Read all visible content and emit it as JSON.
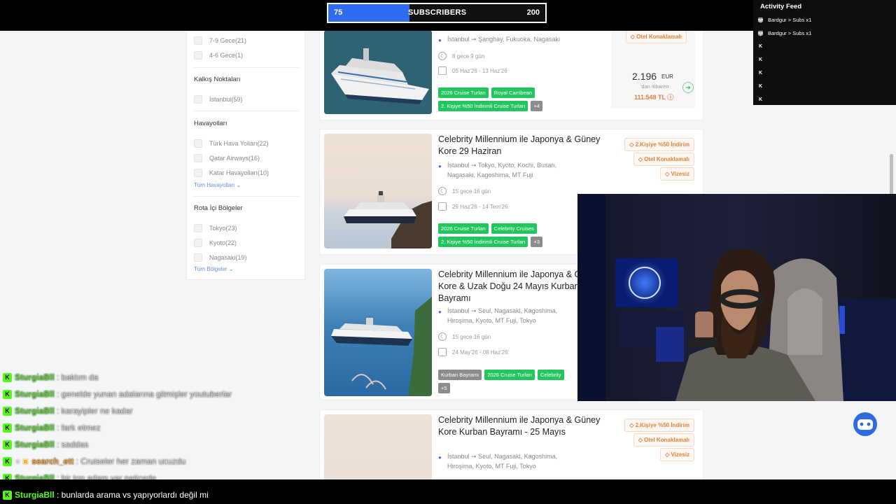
{
  "sub_goal": {
    "current": "75",
    "label": "SUBSCRIBERS",
    "goal": "200",
    "progress": 0.375
  },
  "filters": {
    "nights": [
      {
        "label": "7-9 Gece(21)"
      },
      {
        "label": "4-6 Gece(1)"
      }
    ],
    "departure_title": "Kalkış Noktaları",
    "departure": [
      {
        "label": "İstanbul(59)"
      }
    ],
    "airlines_title": "Havayolları",
    "airlines": [
      {
        "label": "Türk Hava Yolları(22)"
      },
      {
        "label": "Qatar Airways(16)"
      },
      {
        "label": "Katar Havayolları(10)"
      }
    ],
    "airlines_more": "Tüm Havayolları",
    "regions_title": "Rota İçi Bölgeler",
    "regions": [
      {
        "label": "Tokyo(23)"
      },
      {
        "label": "Kyoto(22)"
      },
      {
        "label": "Nagasaki(19)"
      }
    ],
    "regions_more": "Tüm Bölgeler"
  },
  "cards": [
    {
      "route": "İstanbul ➞ Şanghay, Fukuoka, Nagasaki",
      "duration": "8 gece 9 gün",
      "dates": "05 Haz'26 - 13 Haz'26",
      "tags": [
        "2026 Cruise Turları",
        "Royal Carribean",
        "2. Kişiye %50 İndirimli Cruise Turları",
        "+4"
      ],
      "badges": [
        "Otel Konaklamalı"
      ],
      "price": "2.196",
      "currency": "EUR",
      "from": "'dan itibaren",
      "price_tl": "111.548 TL"
    },
    {
      "title": "Celebrity Millennium ile Japonya & Güney Kore 29 Haziran",
      "route": "İstanbul ➞ Tokyo, Kyoto, Kochi, Busan, Nagasaki, Kagoshima, MT Fuji",
      "duration": "15 gece 16 gün",
      "dates": "29 Haz'26 - 14 Tem'26",
      "tags": [
        "2026 Cruise Turları",
        "Celebrity Cruises",
        "2. Kişiye %50 İndirimli Cruise Turları",
        "+3"
      ],
      "badges": [
        "2.Kişiye %50 İndirim",
        "Otel Konaklamalı",
        "Vizesiz"
      ]
    },
    {
      "title": "Celebrity Millennium ile Japonya & Güney Kore & Uzak Doğu 24 Mayıs Kurban Bayramı",
      "route": "İstanbul ➞ Seul, Nagasaki, Kagoshima, Hiroşima, Kyoto, MT Fuji, Tokyo",
      "duration": "15 gece 16 gün",
      "dates": "24 May'26 - 08 Haz'26",
      "tags": [
        "Kurban Bayramı",
        "2026 Cruise Turları",
        "Celebrity",
        "+5"
      ]
    },
    {
      "title": "Celebrity Millennium ile Japonya & Güney Kore Kurban Bayramı - 25 Mayıs",
      "route": "İstanbul ➞ Seul, Nagasaki, Kagoshima, Hiroşima, Kyoto, MT Fuji, Tokyo",
      "badges": [
        "2.Kişiye %50 İndirim",
        "Otel Konaklamalı",
        "Vizesiz"
      ]
    }
  ],
  "activity": {
    "title": "Activity Feed",
    "items": [
      {
        "user": "Bardgur",
        "text": "Subs x1"
      },
      {
        "user": "Bardgur",
        "text": "Subs x1"
      }
    ]
  },
  "chat": [
    {
      "user": "SturgiaBll",
      "msg": ": baktım da"
    },
    {
      "user": "SturgiaBll",
      "msg": ": genelde yunan adalarına gitmişler youtuberlar"
    },
    {
      "user": "SturgiaBll",
      "msg": ": karayipler ne kadar"
    },
    {
      "user": "SturgiaBll",
      "msg": ": fark etmez"
    },
    {
      "user": "SturgiaBll",
      "msg": ": saddas"
    },
    {
      "user": "search_ett",
      "msg": ": Cruiseler her zaman ucuzdu"
    },
    {
      "user": "SturgiaBll",
      "msg": ": bir ton adam var neticede"
    },
    {
      "user": "SturgiaBll",
      "msg": ": bunlarda arama vs yapıyorlardı değil mi"
    }
  ]
}
